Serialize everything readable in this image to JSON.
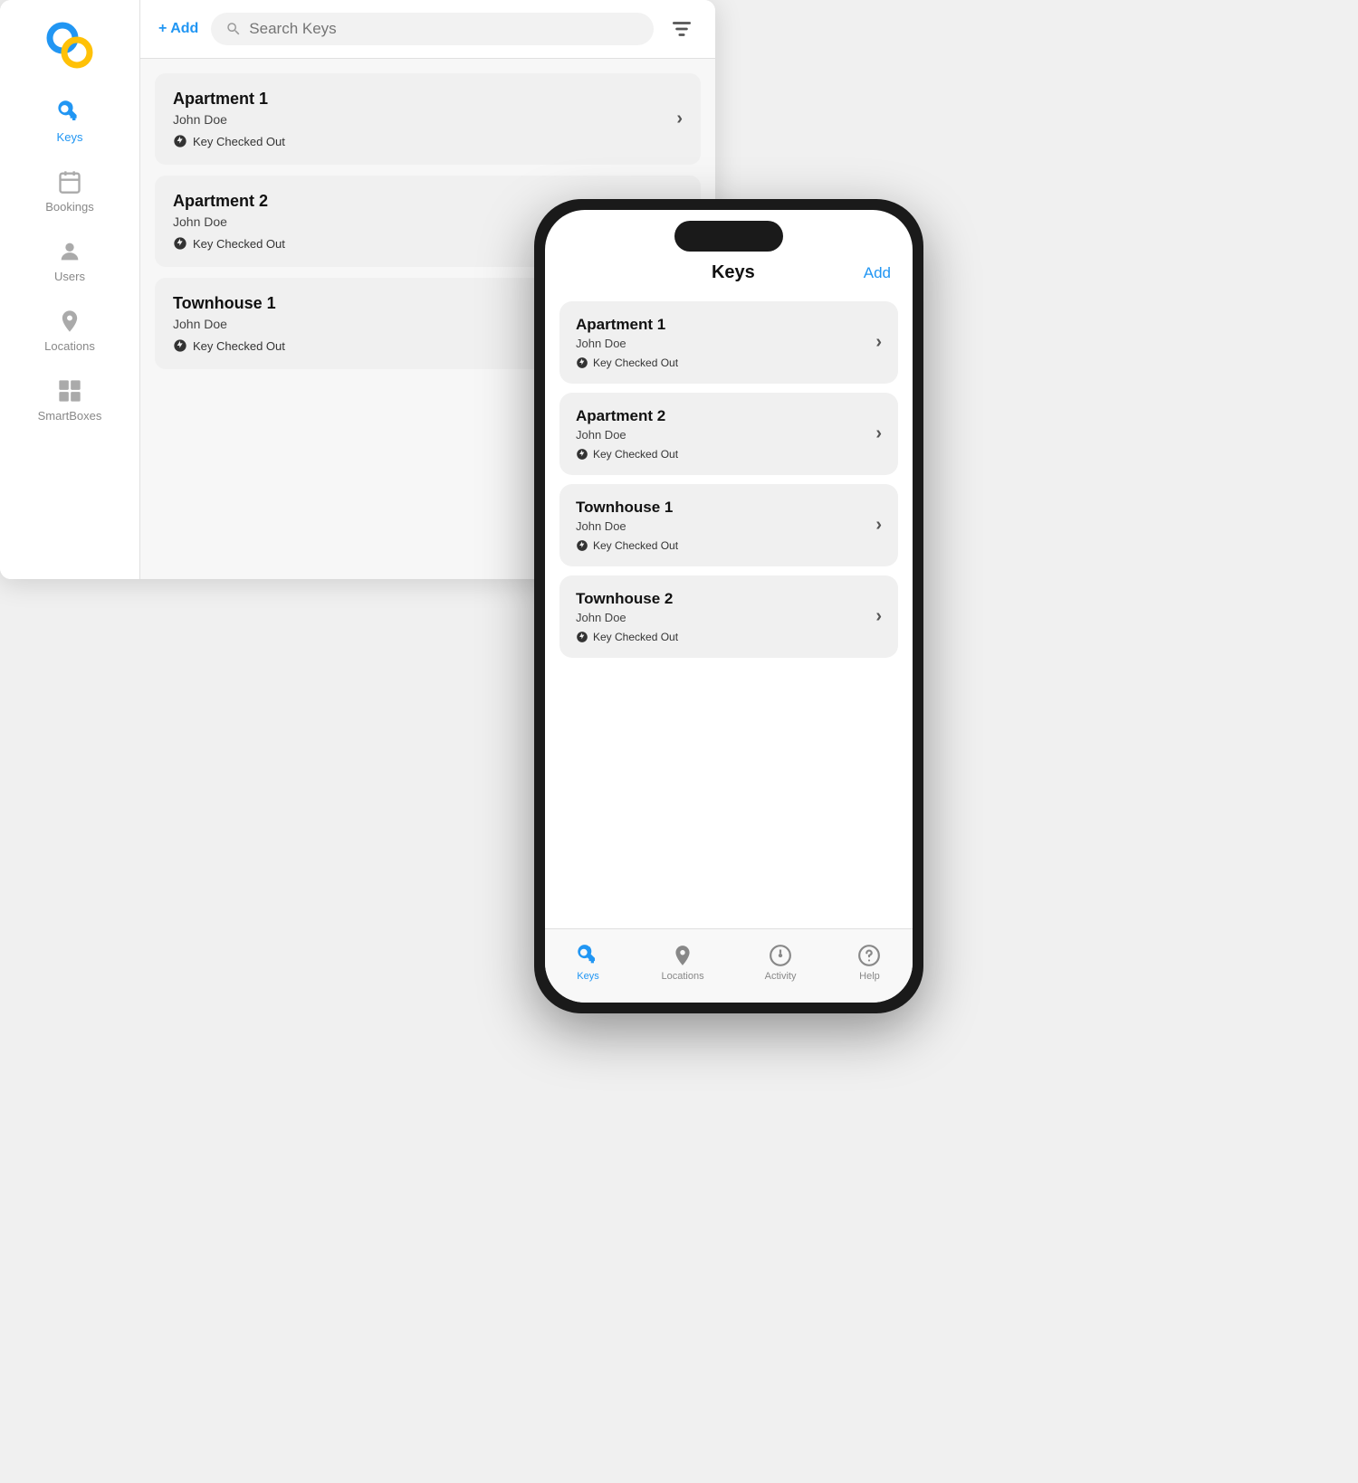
{
  "desktop": {
    "add_button": "+ Add",
    "search_placeholder": "Search Keys",
    "keys": [
      {
        "title": "Apartment 1",
        "user": "John Doe",
        "status": "Key Checked Out"
      },
      {
        "title": "Apartment 2",
        "user": "John Doe",
        "status": "Key Checked Out"
      },
      {
        "title": "Townhouse 1",
        "user": "John Doe",
        "status": "Key Checked Out"
      }
    ],
    "sidebar": {
      "items": [
        {
          "id": "keys",
          "label": "Keys",
          "active": true
        },
        {
          "id": "bookings",
          "label": "Bookings",
          "active": false
        },
        {
          "id": "users",
          "label": "Users",
          "active": false
        },
        {
          "id": "locations",
          "label": "Locations",
          "active": false
        },
        {
          "id": "smartboxes",
          "label": "SmartBoxes",
          "active": false
        }
      ]
    }
  },
  "phone": {
    "title": "Keys",
    "add_button": "Add",
    "keys": [
      {
        "title": "Apartment 1",
        "user": "John Doe",
        "status": "Key Checked Out"
      },
      {
        "title": "Apartment 2",
        "user": "John Doe",
        "status": "Key Checked Out"
      },
      {
        "title": "Townhouse 1",
        "user": "John Doe",
        "status": "Key Checked Out"
      },
      {
        "title": "Townhouse 2",
        "user": "John Doe",
        "status": "Key Checked Out"
      }
    ],
    "tabs": [
      {
        "id": "keys",
        "label": "Keys",
        "active": true
      },
      {
        "id": "locations",
        "label": "Locations",
        "active": false
      },
      {
        "id": "activity",
        "label": "Activity",
        "active": false
      },
      {
        "id": "help",
        "label": "Help",
        "active": false
      }
    ]
  }
}
